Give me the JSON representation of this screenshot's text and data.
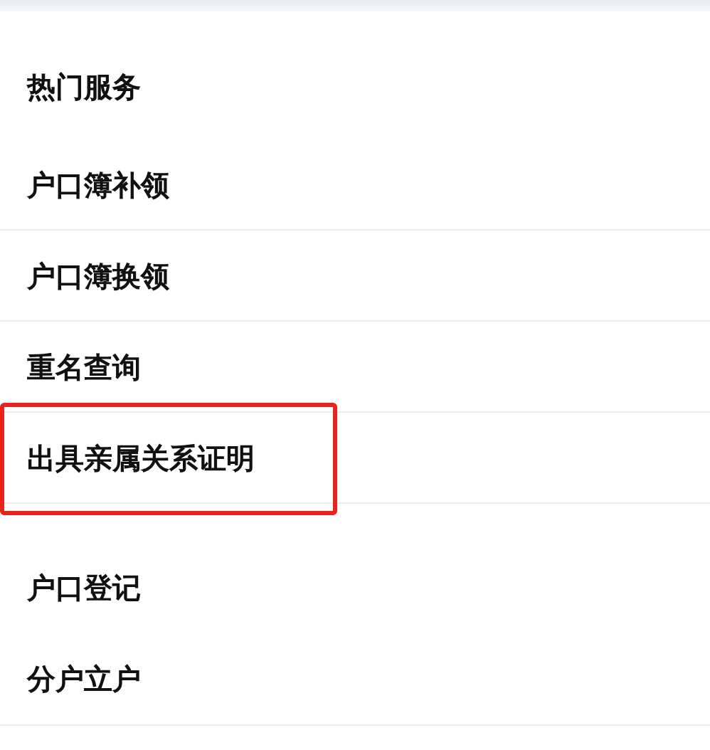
{
  "sections": [
    {
      "title": "热门服务",
      "dividers": true,
      "items": [
        {
          "label": "户口簿补领",
          "highlighted": false
        },
        {
          "label": "户口簿换领",
          "highlighted": false
        },
        {
          "label": "重名查询",
          "highlighted": false
        },
        {
          "label": "出具亲属关系证明",
          "highlighted": true
        }
      ]
    },
    {
      "dividers": false,
      "items": [
        {
          "label": "户口登记",
          "highlighted": false
        },
        {
          "label": "分户立户",
          "highlighted": false
        }
      ]
    }
  ]
}
